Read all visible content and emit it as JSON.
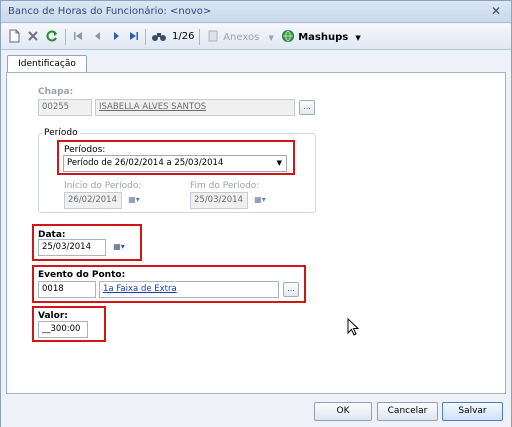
{
  "window": {
    "title": "Banco de Horas do Funcionário: <novo>",
    "close_symbol": "✕"
  },
  "toolbar": {
    "new_icon": "new-document-icon",
    "delete_icon": "delete-x-icon",
    "refresh_icon": "refresh-icon",
    "first_icon": "first-record-icon",
    "prev_icon": "previous-record-icon",
    "next_icon": "next-record-icon",
    "last_icon": "last-record-icon",
    "search_icon": "binoculars-icon",
    "record_position": "1/26",
    "attachments_label": "Anexos",
    "mashups_label": "Mashups"
  },
  "tabs": [
    {
      "label": "Identificação",
      "selected": true
    }
  ],
  "form": {
    "chapa": {
      "label": "Chapa:",
      "code": "00255",
      "name": "ISABELLA ALVES SANTOS",
      "lookup": "..."
    },
    "periodo": {
      "group_title": "Período",
      "periodos_label": "Períodos:",
      "selected_period": "Período de 26/02/2014 a 25/03/2014",
      "inicio_label": "Início do Período:",
      "inicio_value": "26/02/2014",
      "fim_label": "Fim do Período:",
      "fim_value": "25/03/2014"
    },
    "data": {
      "label": "Data:",
      "value": "25/03/2014"
    },
    "evento": {
      "label": "Evento do Ponto:",
      "code": "0018",
      "description": "1a Faixa de Extra",
      "lookup": "..."
    },
    "valor": {
      "label": "Valor:",
      "value": "__300:00"
    }
  },
  "footer": {
    "ok_label": "OK",
    "cancel_label": "Cancelar",
    "save_label": "Salvar"
  },
  "colors": {
    "highlight_border": "#d01616",
    "link": "#1a3cb0",
    "title_text": "#2b4a74"
  }
}
